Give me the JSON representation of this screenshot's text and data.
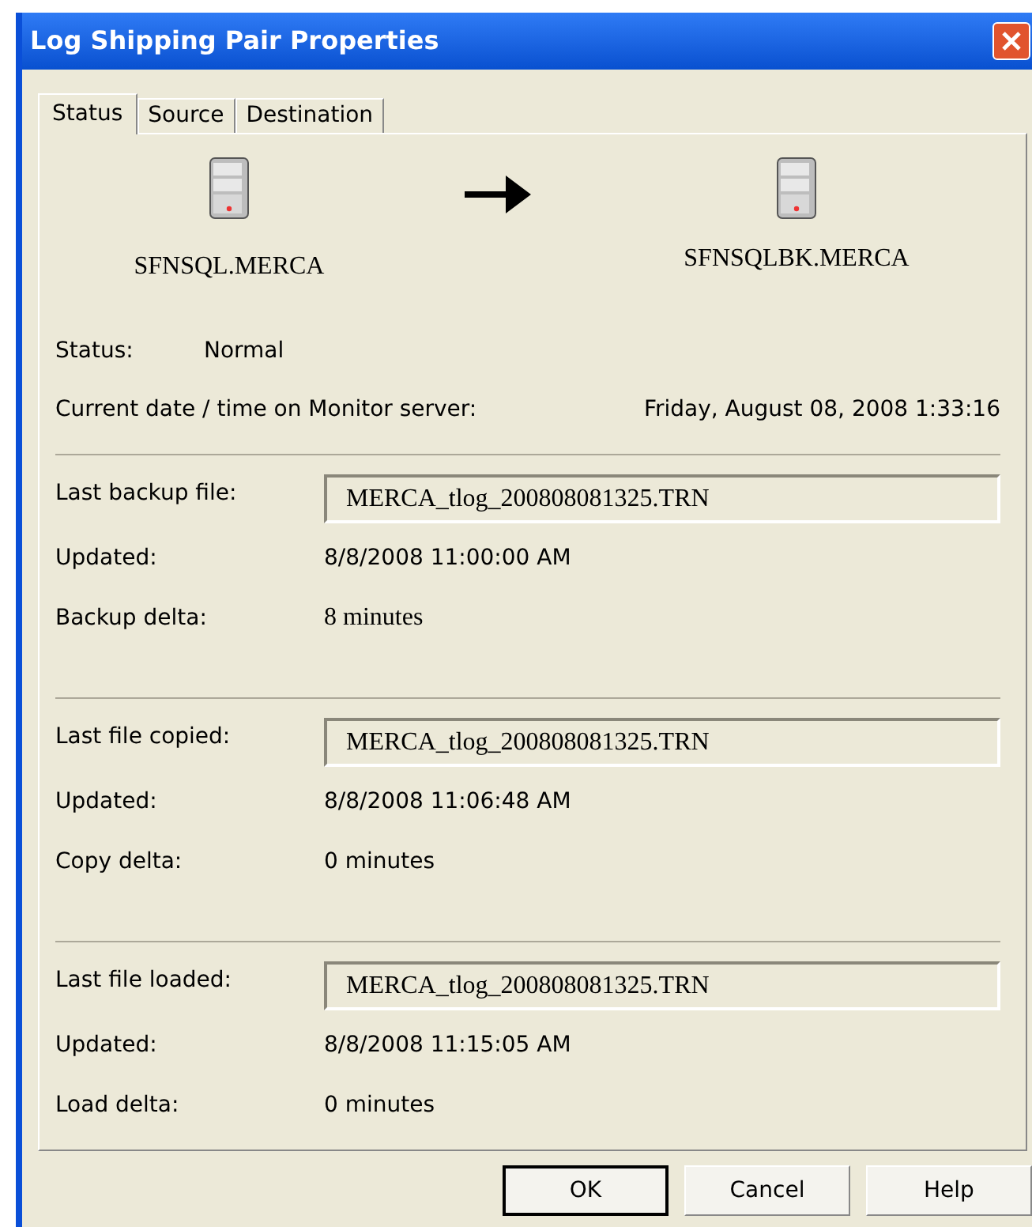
{
  "window": {
    "title": "Log Shipping Pair Properties"
  },
  "tabs": [
    {
      "label": "Status",
      "selected": true
    },
    {
      "label": "Source",
      "selected": false
    },
    {
      "label": "Destination",
      "selected": false
    }
  ],
  "servers": {
    "primary": "SFNSQL.MERCA",
    "secondary": "SFNSQLBK.MERCA"
  },
  "status": {
    "label": "Status:",
    "value": "Normal"
  },
  "current_time": {
    "label": "Current date / time on Monitor server:",
    "value": "Friday, August 08, 2008 1:33:16"
  },
  "sections": [
    {
      "file_label": "Last backup file:",
      "file": "MERCA_tlog_200808081325.TRN",
      "updated_label": "Updated:",
      "updated": "8/8/2008 11:00:00 AM",
      "delta_label": "Backup delta:",
      "delta": "8 minutes"
    },
    {
      "file_label": "Last file copied:",
      "file": "MERCA_tlog_200808081325.TRN",
      "updated_label": "Updated:",
      "updated": "8/8/2008 11:06:48 AM",
      "delta_label": "Copy delta:",
      "delta": "0 minutes"
    },
    {
      "file_label": "Last file loaded:",
      "file": "MERCA_tlog_200808081325.TRN",
      "updated_label": "Updated:",
      "updated": "8/8/2008 11:15:05 AM",
      "delta_label": "Load delta:",
      "delta": "0 minutes"
    }
  ],
  "buttons": [
    {
      "label": "OK",
      "default": true
    },
    {
      "label": "Cancel",
      "default": false
    },
    {
      "label": "Help",
      "default": false
    }
  ]
}
